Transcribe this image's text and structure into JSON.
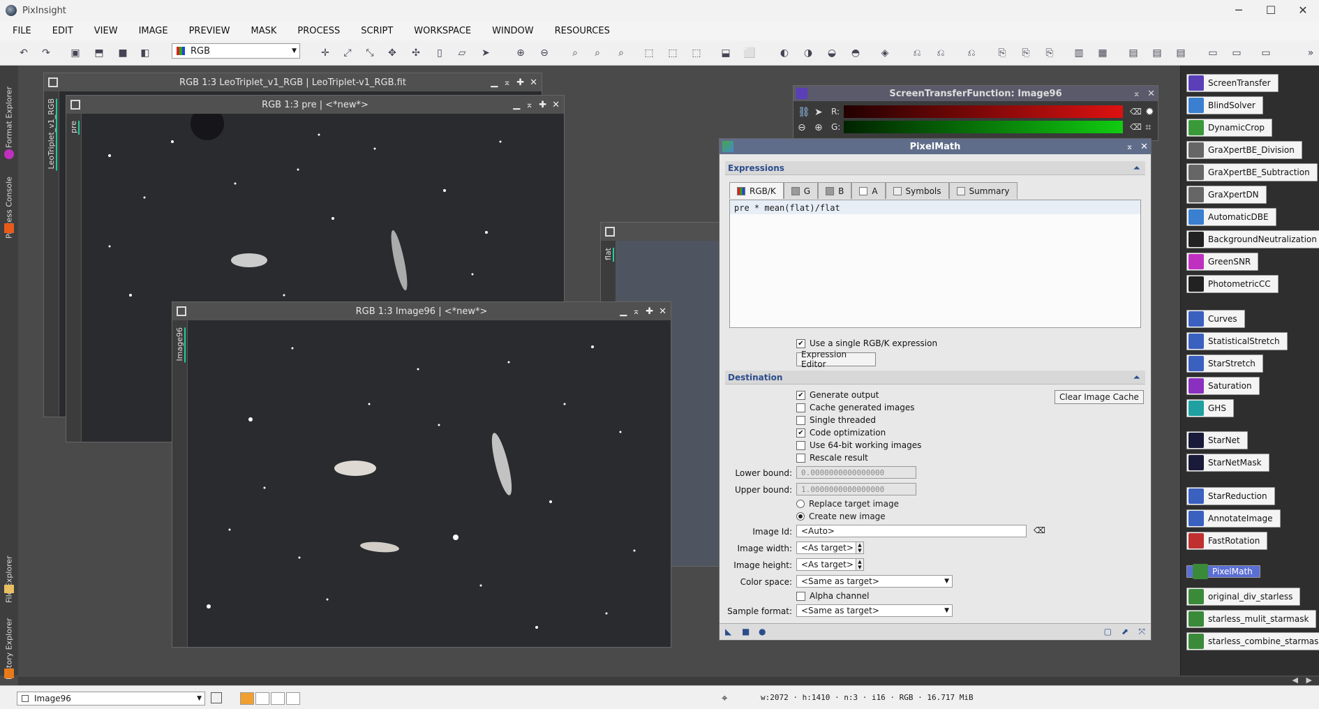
{
  "app": {
    "title": "PixInsight",
    "window_controls": [
      "─",
      "☐",
      "✕"
    ]
  },
  "menu": [
    "FILE",
    "EDIT",
    "VIEW",
    "IMAGE",
    "PREVIEW",
    "MASK",
    "PROCESS",
    "SCRIPT",
    "WORKSPACE",
    "WINDOW",
    "RESOURCES"
  ],
  "toolbar": {
    "color_mode": "RGB"
  },
  "left_tabs": {
    "format_explorer": "Format Explorer",
    "process_console": "Process Console",
    "file_explorer": "File Explorer",
    "history_explorer": "History Explorer"
  },
  "windows": {
    "leo": {
      "title": "RGB 1:3 LeoTriplet_v1_RGB | LeoTriplet-v1_RGB.fit",
      "side": "LeoTriplet_v1_RGB"
    },
    "pre": {
      "title": "RGB 1:3 pre | <*new*>",
      "side": "pre"
    },
    "flat": {
      "side": "flat"
    },
    "image96": {
      "title": "RGB 1:3 Image96 | <*new*>",
      "side": "Image96"
    },
    "controls": [
      "▁",
      "⌅",
      "✚",
      "✕"
    ]
  },
  "stf": {
    "title": "ScreenTransferFunction: Image96",
    "r_label": "R:",
    "g_label": "G:"
  },
  "pixelmath": {
    "title": "PixelMath",
    "expressions_header": "Expressions",
    "tabs": [
      "RGB/K",
      "G",
      "B",
      "A",
      "Symbols",
      "Summary"
    ],
    "expression": "pre * mean(flat)/flat",
    "use_single": "Use a single RGB/K expression",
    "expression_editor": "Expression Editor",
    "destination_header": "Destination",
    "generate_output": "Generate output",
    "cache_generated": "Cache generated images",
    "single_threaded": "Single threaded",
    "code_optimization": "Code optimization",
    "use_64bit": "Use 64-bit working images",
    "rescale_result": "Rescale result",
    "clear_cache": "Clear Image Cache",
    "lower_bound_label": "Lower bound:",
    "lower_bound": "0.0000000000000000",
    "upper_bound_label": "Upper bound:",
    "upper_bound": "1.0000000000000000",
    "replace_target": "Replace target image",
    "create_new": "Create new image",
    "image_id_label": "Image Id:",
    "image_id": "<Auto>",
    "image_width_label": "Image width:",
    "image_width": "<As target>",
    "image_height_label": "Image height:",
    "image_height": "<As target>",
    "color_space_label": "Color space:",
    "color_space": "<Same as target>",
    "alpha_channel": "Alpha channel",
    "sample_format_label": "Sample format:",
    "sample_format": "<Same as target>"
  },
  "process_icons": [
    {
      "label": "ScreenTransfer",
      "color": "#5a3fb8"
    },
    {
      "label": "BlindSolver",
      "color": "#3a7fd0"
    },
    {
      "label": "DynamicCrop",
      "color": "#3a9a3a"
    },
    {
      "label": "GraXpertBE_Division",
      "color": "#666666"
    },
    {
      "label": "GraXpertBE_Subtraction",
      "color": "#666666"
    },
    {
      "label": "GraXpertDN",
      "color": "#666666"
    },
    {
      "label": "AutomaticDBE",
      "color": "#3a7fd0"
    },
    {
      "label": "BackgroundNeutralization",
      "color": "#222222"
    },
    {
      "label": "GreenSNR",
      "color": "#c030c0"
    },
    {
      "label": "PhotometricCC",
      "color": "#222222"
    },
    {
      "label": "Curves",
      "color": "#3a60c0"
    },
    {
      "label": "StatisticalStretch",
      "color": "#3a60c0"
    },
    {
      "label": "StarStretch",
      "color": "#3a60c0"
    },
    {
      "label": "Saturation",
      "color": "#8a30c0"
    },
    {
      "label": "GHS",
      "color": "#20a0a0"
    },
    {
      "label": "StarNet",
      "color": "#1a1a3a"
    },
    {
      "label": "StarNetMask",
      "color": "#1a1a3a"
    },
    {
      "label": "StarReduction",
      "color": "#3a60c0"
    },
    {
      "label": "AnnotateImage",
      "color": "#3a60c0"
    },
    {
      "label": "FastRotation",
      "color": "#c03030"
    },
    {
      "label": "PixelMath",
      "color": "#3a8a3a"
    },
    {
      "label": "original_div_starless",
      "color": "#3a8a3a"
    },
    {
      "label": "starless_mulit_starmask",
      "color": "#3a8a3a"
    },
    {
      "label": "starless_combine_starmask",
      "color": "#3a8a3a"
    }
  ],
  "status": {
    "view": "Image96",
    "info": "w:2072 · h:1410 · n:3 · i16 · RGB · 16.717 MiB"
  }
}
